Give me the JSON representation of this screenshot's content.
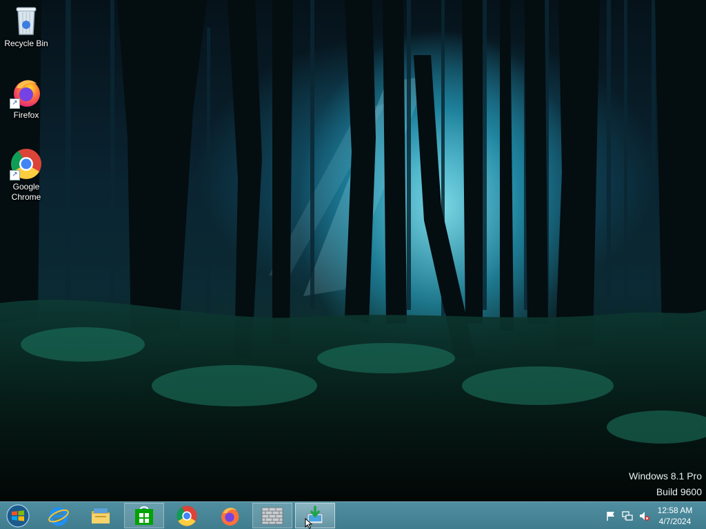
{
  "desktop": {
    "icons": [
      {
        "label": "Recycle Bin",
        "icon": "recycle-bin-icon"
      },
      {
        "label": "Firefox",
        "icon": "firefox-icon"
      },
      {
        "label": "Google Chrome",
        "icon": "chrome-icon"
      }
    ],
    "watermark": {
      "line1": "Windows 8.1 Pro",
      "line2": "Build 9600"
    }
  },
  "taskbar": {
    "start": {
      "icon": "windows-start-icon"
    },
    "apps": [
      {
        "name": "Internet Explorer",
        "icon": "internet-explorer-icon",
        "state": "pinned"
      },
      {
        "name": "File Explorer",
        "icon": "file-explorer-icon",
        "state": "pinned"
      },
      {
        "name": "Store",
        "icon": "store-icon",
        "state": "open"
      },
      {
        "name": "Google Chrome",
        "icon": "chrome-icon",
        "state": "pinned"
      },
      {
        "name": "Firefox",
        "icon": "firefox-icon",
        "state": "pinned"
      },
      {
        "name": "Firewall",
        "icon": "brick-wall-icon",
        "state": "open"
      },
      {
        "name": "Installer",
        "icon": "install-download-icon",
        "state": "active"
      }
    ],
    "tray": {
      "icons": [
        "action-center-flag-icon",
        "network-icon",
        "volume-muted-icon"
      ],
      "time": "12:58 AM",
      "date": "4/7/2024"
    }
  },
  "colors": {
    "taskbar": "#4a8899",
    "store_green": "#00a300",
    "text": "#ffffff"
  }
}
